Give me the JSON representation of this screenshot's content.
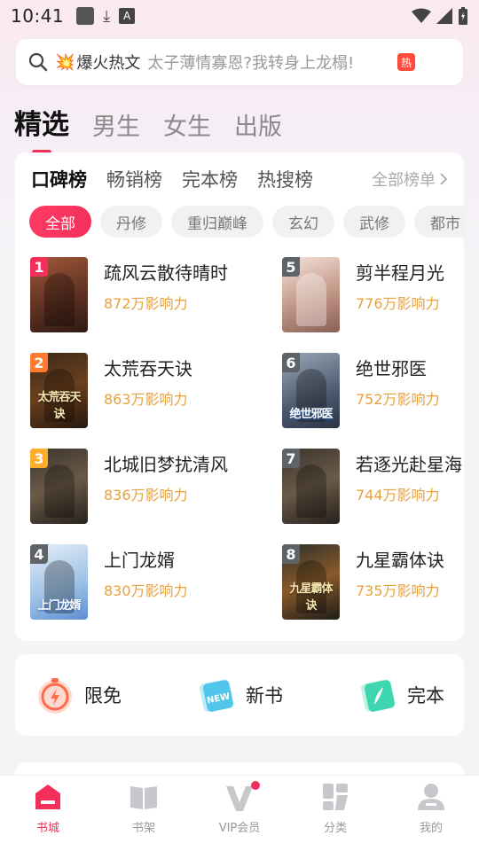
{
  "status_bar": {
    "time": "10:41",
    "a_icon": "A"
  },
  "search": {
    "hot_label": "爆火热文",
    "hint": "太子薄情寡恩?我转身上龙榻!",
    "hot_badge": "热"
  },
  "main_tabs": [
    {
      "label": "精选",
      "active": true
    },
    {
      "label": "男生",
      "active": false
    },
    {
      "label": "女生",
      "active": false
    },
    {
      "label": "出版",
      "active": false
    }
  ],
  "rank_tabs": [
    {
      "label": "口碑榜",
      "active": true
    },
    {
      "label": "畅销榜",
      "active": false
    },
    {
      "label": "完本榜",
      "active": false
    },
    {
      "label": "热搜榜",
      "active": false
    }
  ],
  "all_lists_label": "全部榜单",
  "chips": [
    "全部",
    "丹修",
    "重归巅峰",
    "玄幻",
    "武修",
    "都市"
  ],
  "books_left": [
    {
      "rank": "1",
      "title": "疏风云散待晴时",
      "influence": "872万影响力",
      "cover_text": "",
      "rank_color": "#f2305a"
    },
    {
      "rank": "2",
      "title": "太荒吞天诀",
      "influence": "863万影响力",
      "cover_text": "太荒吞天诀",
      "rank_color": "#ff7a2e"
    },
    {
      "rank": "3",
      "title": "北城旧梦扰清风",
      "influence": "836万影响力",
      "cover_text": "",
      "rank_color": "#ffae2b"
    },
    {
      "rank": "4",
      "title": "上门龙婿",
      "influence": "830万影响力",
      "cover_text": "上门龙婿",
      "rank_color": "#5f6368"
    }
  ],
  "books_right": [
    {
      "rank": "5",
      "title": "剪半程月光",
      "influence": "776万影响力",
      "cover_text": "",
      "rank_color": "#5f6368"
    },
    {
      "rank": "6",
      "title": "绝世邪医",
      "influence": "752万影响力",
      "cover_text": "绝世邪医",
      "rank_color": "#5f6368"
    },
    {
      "rank": "7",
      "title": "若逐光赴星海",
      "influence": "744万影响力",
      "cover_text": "",
      "rank_color": "#5f6368"
    },
    {
      "rank": "8",
      "title": "九星霸体诀",
      "influence": "735万影响力",
      "cover_text": "九星霸体诀",
      "rank_color": "#5f6368"
    }
  ],
  "quick_entries": [
    {
      "label": "限免",
      "icon": "stopwatch-icon"
    },
    {
      "label": "新书",
      "icon": "new-book-icon"
    },
    {
      "label": "完本",
      "icon": "finished-book-icon"
    }
  ],
  "new_badge": "NEW",
  "bottom_nav": [
    {
      "label": "书城",
      "icon": "bookstore-icon",
      "active": true
    },
    {
      "label": "书架",
      "icon": "bookshelf-icon",
      "active": false
    },
    {
      "label": "VIP会员",
      "icon": "vip-icon",
      "active": false
    },
    {
      "label": "分类",
      "icon": "category-icon",
      "active": false
    },
    {
      "label": "我的",
      "icon": "profile-icon",
      "active": false
    }
  ],
  "colors": {
    "accent": "#f2305a",
    "influence": "#e8a13a"
  }
}
